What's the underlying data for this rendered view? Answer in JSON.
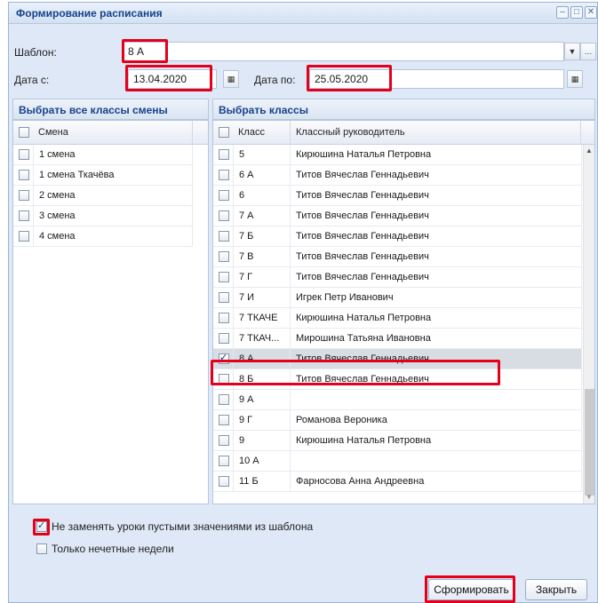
{
  "dialog": {
    "title": "Формирование расписания",
    "window_buttons": [
      "–",
      "□",
      "✕"
    ]
  },
  "form": {
    "template_label": "Шаблон:",
    "template_value": "8 А",
    "date_from_label": "Дата с:",
    "date_from_value": "13.04.2020",
    "date_to_label": "Дата по:",
    "date_to_value": "25.05.2020"
  },
  "shifts_panel": {
    "title": "Выбрать все классы смены",
    "header": "Смена",
    "rows": [
      "1 смена",
      "1 смена Ткачёва",
      "2 смена",
      "3 смена",
      "4 смена"
    ]
  },
  "classes_panel": {
    "title": "Выбрать классы",
    "headers": [
      "Класс",
      "Классный руководитель"
    ],
    "rows": [
      {
        "cls": "5",
        "teacher": "Кирюшина Наталья Петровна",
        "checked": false
      },
      {
        "cls": "6 А",
        "teacher": "Титов Вячеслав Геннадьевич",
        "checked": false
      },
      {
        "cls": "6",
        "teacher": "Титов Вячеслав Геннадьевич",
        "checked": false
      },
      {
        "cls": "7 А",
        "teacher": "Титов Вячеслав Геннадьевич",
        "checked": false
      },
      {
        "cls": "7 Б",
        "teacher": "Титов Вячеслав Геннадьевич",
        "checked": false
      },
      {
        "cls": "7 В",
        "teacher": "Титов Вячеслав Геннадьевич",
        "checked": false
      },
      {
        "cls": "7 Г",
        "teacher": "Титов Вячеслав Геннадьевич",
        "checked": false
      },
      {
        "cls": "7 И",
        "teacher": "Игрек Петр Иванович",
        "checked": false
      },
      {
        "cls": "7 ТКАЧЕ",
        "teacher": "Кирюшина Наталья Петровна",
        "checked": false
      },
      {
        "cls": "7 ТКАЧ...",
        "teacher": "Мирошина Татьяна Ивановна",
        "checked": false
      },
      {
        "cls": "8 А",
        "teacher": "Титов Вячеслав Геннадьевич",
        "checked": true
      },
      {
        "cls": "8 Б",
        "teacher": "Титов Вячеслав Геннадьевич",
        "checked": false
      },
      {
        "cls": "9 А",
        "teacher": "",
        "checked": false
      },
      {
        "cls": "9 Г",
        "teacher": "Романова Вероника",
        "checked": false
      },
      {
        "cls": "9",
        "teacher": "Кирюшина Наталья Петровна",
        "checked": false
      },
      {
        "cls": "10 А",
        "teacher": "",
        "checked": false
      },
      {
        "cls": "11 Б",
        "teacher": "Фарносова Анна Андреевна",
        "checked": false
      }
    ]
  },
  "options": {
    "keep_lessons_label": "Не заменять уроки пустыми значениями из шаблона",
    "keep_lessons_checked": true,
    "odd_weeks_label": "Только нечетные недели",
    "odd_weeks_checked": false
  },
  "buttons": {
    "generate": "Сформировать",
    "close": "Закрыть"
  },
  "colors": {
    "highlight": "#e4001b",
    "title_text": "#15428b"
  }
}
